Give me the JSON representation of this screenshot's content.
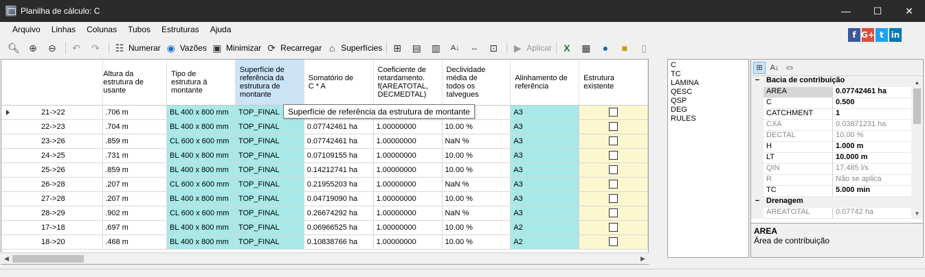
{
  "window": {
    "title": "Planilha de cálculo: C",
    "min": "—",
    "max": "☐",
    "close": "✕"
  },
  "menu": [
    "Arquivo",
    "Linhas",
    "Colunas",
    "Tubos",
    "Estruturas",
    "Ajuda"
  ],
  "toolbar": {
    "numerar": "Numerar",
    "vazoes": "Vazões",
    "minimizar": "Minimizar",
    "recarregar": "Recarregar",
    "superficies": "Superfícies",
    "aplicar": "Aplicar"
  },
  "social": [
    {
      "label": "f",
      "color": "#3b5998"
    },
    {
      "label": "G+",
      "color": "#dd4b39"
    },
    {
      "label": "t",
      "color": "#1da1f2"
    },
    {
      "label": "in",
      "color": "#0077b5"
    }
  ],
  "grid": {
    "headers": [
      "",
      "Altura da estrutura de jusante",
      "Tipo de estrutura à montante",
      "Superfície de referência da estrutura de montante",
      "Somatório de C * A",
      "Coeficiente de retardamento. f(AREATOTAL, DECMEDTAL)",
      "Declividade média de todos os talvegues",
      "Alinhamento de referência",
      "Estrutura existente"
    ],
    "header_visible": [
      "",
      "Altura da\nestrutura de\nusante",
      "Tipo de\nestrutura à\nmontante",
      "Superfície de\nreferência da\nestrutura de\nmontante",
      "Somatório de\nC * A",
      "Coeficiente de\nretardamento.\nf(AREATOTAL,\nDECMEDTAL)",
      "Declividade\nmédia de\ntodos os\ntalvegues",
      "Alinhamento de\nreferência",
      "Estrutura existente"
    ],
    "rows": [
      [
        "21->22",
        ".706 m",
        "BL 400 x 800 mm",
        "TOP_FINAL",
        "",
        "",
        "",
        "A3"
      ],
      [
        "22->23",
        ".704 m",
        "BL 400 x 800 mm",
        "TOP_FINAL",
        "0.07742461 ha",
        "1.00000000",
        "10.00 %",
        "A3"
      ],
      [
        "23->26",
        ".859 m",
        "CL 600 x 600 mm",
        "TOP_FINAL",
        "0.07742461 ha",
        "1.00000000",
        "NaN %",
        "A3"
      ],
      [
        "24->25",
        ".731 m",
        "BL 400 x 800 mm",
        "TOP_FINAL",
        "0.07109155 ha",
        "1.00000000",
        "10.00 %",
        "A3"
      ],
      [
        "25->26",
        ".859 m",
        "BL 400 x 800 mm",
        "TOP_FINAL",
        "0.14212741 ha",
        "1.00000000",
        "10.00 %",
        "A3"
      ],
      [
        "26->28",
        ".207 m",
        "CL 600 x 600 mm",
        "TOP_FINAL",
        "0.21955203 ha",
        "1.00000000",
        "NaN %",
        "A3"
      ],
      [
        "27->28",
        ".207 m",
        "BL 400 x 800 mm",
        "TOP_FINAL",
        "0.04719090 ha",
        "1.00000000",
        "10.00 %",
        "A3"
      ],
      [
        "28->29",
        ".902 m",
        "CL 600 x 600 mm",
        "TOP_FINAL",
        "0.26674292 ha",
        "1.00000000",
        "NaN %",
        "A3"
      ],
      [
        "17->18",
        ".697 m",
        "BL 400 x 800 mm",
        "TOP_FINAL",
        "0.06966525 ha",
        "1.00000000",
        "10.00 %",
        "A2"
      ],
      [
        "18->20",
        ".468 m",
        "BL 400 x 800 mm",
        "TOP_FINAL",
        "0.10838766 ha",
        "1.00000000",
        "10.00 %",
        "A2"
      ]
    ]
  },
  "tooltip": "Superfície de referência da estrutura de montante",
  "varlist": [
    "C",
    "TC",
    "LAMINA",
    "QESC",
    "QSP",
    "DEG",
    "RULES"
  ],
  "props": {
    "categories": [
      {
        "name": "Bacia de contribuição",
        "items": [
          {
            "name": "AREA",
            "value": "0.07742461 ha",
            "bold": true,
            "selected": true
          },
          {
            "name": "C",
            "value": "0.500",
            "bold": true
          },
          {
            "name": "CATCHMENT",
            "value": "1",
            "bold": true
          },
          {
            "name": "CXA",
            "value": "0.03871231 ha",
            "gray": true
          },
          {
            "name": "DECTAL",
            "value": "10.00 %",
            "gray": true
          },
          {
            "name": "H",
            "value": "1.000 m",
            "bold": true
          },
          {
            "name": "LT",
            "value": "10.000 m",
            "bold": true
          },
          {
            "name": "QIN",
            "value": "17.485 l/s",
            "gray": true
          },
          {
            "name": "R",
            "value": "Não se aplica",
            "gray": true
          },
          {
            "name": "TC",
            "value": "5.000 min",
            "bold": true
          }
        ]
      },
      {
        "name": "Drenagem",
        "items": [
          {
            "name": "AREATOTAL",
            "value": "0.07742 ha",
            "gray": true
          }
        ]
      }
    ],
    "desc_title": "AREA",
    "desc_text": "Área de contribuição"
  }
}
